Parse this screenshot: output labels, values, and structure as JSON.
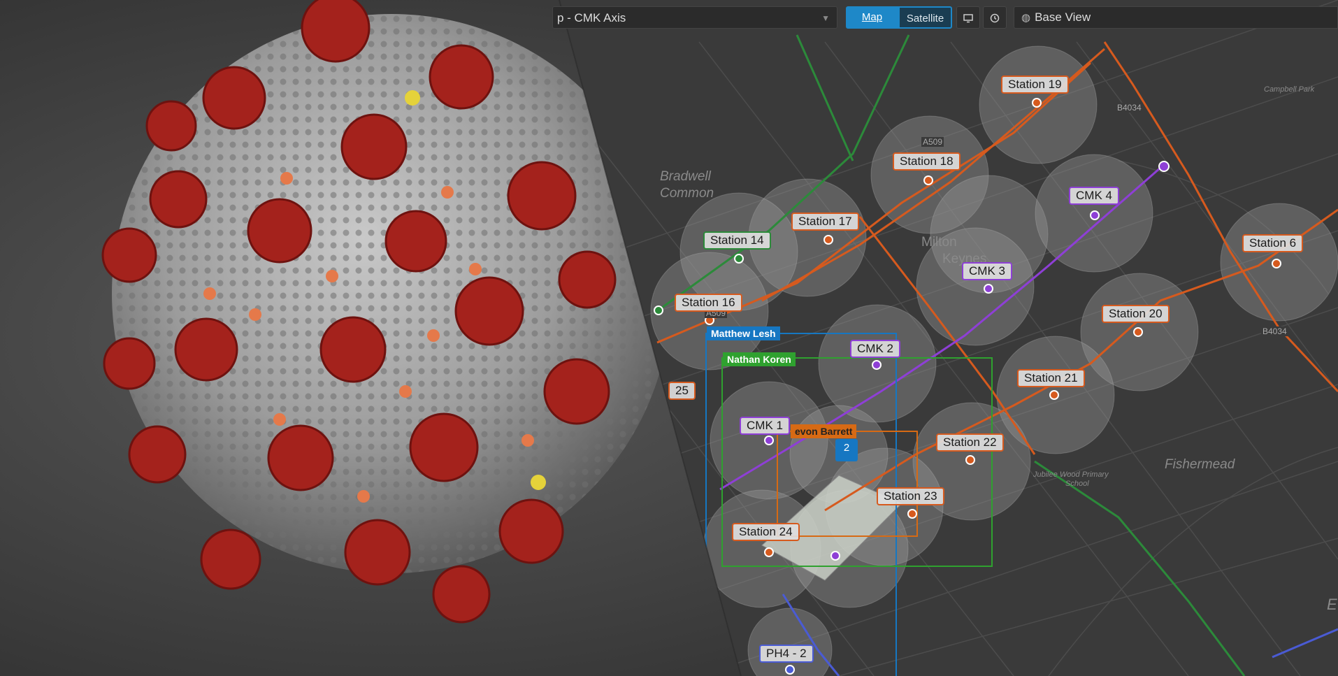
{
  "toolbar": {
    "title": "p - CMK Axis",
    "map_label": "Map",
    "satellite_label": "Satellite",
    "base_view_label": "Base View"
  },
  "areas": {
    "bradwell_line1": "Bradwell",
    "bradwell_line2": "Common",
    "milton_line1": "Milton",
    "milton_line2": "Keynes",
    "fishermead": "Fishermead",
    "campbell_park": "Campbell Park",
    "jubilee_line1": "Jubilee Wood Primary",
    "jubilee_line2": "School",
    "edge_letter": "E"
  },
  "roads": {
    "a509_top": "A509",
    "a509_left": "A509",
    "b4034_top": "B4034",
    "b4034_right": "B4034"
  },
  "stations": {
    "s19": "Station 19",
    "s18": "Station 18",
    "s17": "Station 17",
    "s14": "Station 14",
    "s16": "Station 16",
    "s6": "Station 6",
    "s20": "Station 20",
    "s21": "Station 21",
    "s22": "Station 22",
    "s23": "Station 23",
    "s24": "Station 24",
    "s25": "25",
    "cmk1": "CMK 1",
    "cmk2": "CMK 2",
    "cmk3": "CMK 3",
    "cmk4": "CMK 4",
    "ph4": "PH4 - 2"
  },
  "people": {
    "matthew": "Matthew Lesh",
    "nathan": "Nathan Koren",
    "devon": "evon Barrett"
  },
  "cluster_badge": "2",
  "colors": {
    "route_orange": "#d65a1e",
    "route_green": "#2c8a3a",
    "route_purple": "#8e3fd6",
    "map_bg": "#3a3a3a",
    "accent_blue": "#1e88c8"
  },
  "icons": {
    "caret": "chevron-down-icon",
    "monitor": "monitor-icon",
    "clock": "clock-icon",
    "globe": "globe-icon"
  }
}
